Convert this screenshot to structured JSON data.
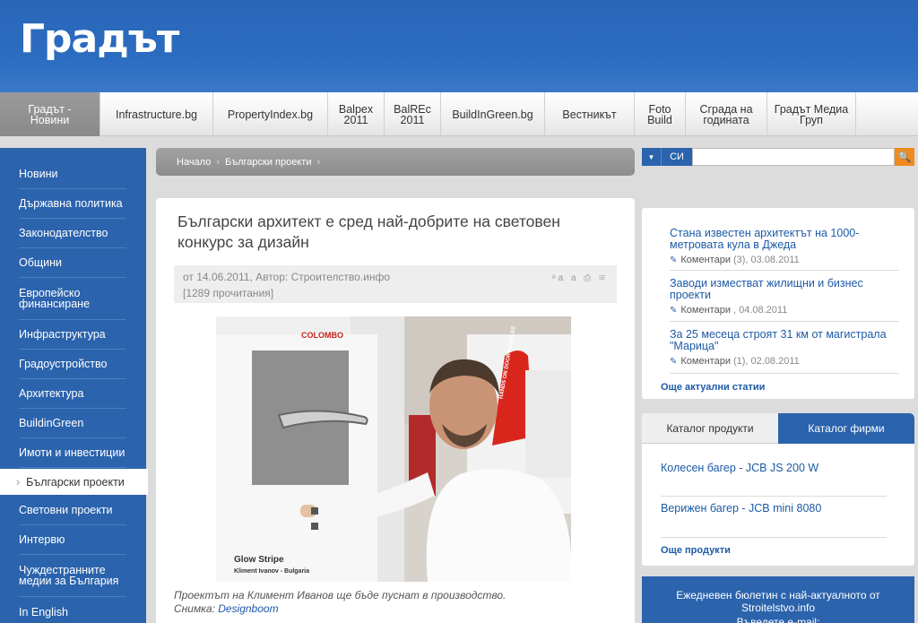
{
  "logo": "Градът",
  "topnav": [
    {
      "label": "Градът -\nНовини",
      "active": true
    },
    {
      "label": "Infrastructure.bg"
    },
    {
      "label": "PropertyIndex.bg"
    },
    {
      "label": "Balpex\n2011"
    },
    {
      "label": "BalREc\n2011"
    },
    {
      "label": "BuildInGreen.bg"
    },
    {
      "label": "Вестникът"
    },
    {
      "label": "Foto\nBuild"
    },
    {
      "label": "Сграда на\nгодината"
    },
    {
      "label": "Градът Медиа\nГруп"
    }
  ],
  "sidebar": [
    {
      "label": "Новини"
    },
    {
      "label": "Държавна политика"
    },
    {
      "label": "Законодателство"
    },
    {
      "label": "Общини"
    },
    {
      "label": "Европейско финансиране"
    },
    {
      "label": "Инфраструктура"
    },
    {
      "label": "Градоустройство"
    },
    {
      "label": "Архитектура"
    },
    {
      "label": "BuildinGreen"
    },
    {
      "label": "Имоти и инвестиции"
    },
    {
      "label": "Български проекти",
      "active": true
    },
    {
      "label": "Световни проекти"
    },
    {
      "label": "Интервю"
    },
    {
      "label": "Чуждестранните медии за България"
    },
    {
      "label": "In English"
    }
  ],
  "breadcrumb": {
    "home": "Начало",
    "current": "Български проекти",
    "sep": "›"
  },
  "article": {
    "title": "Български архитект е сред най-добрите на световен конкурс за дизайн",
    "meta_line1": "от 14.06.2011, Автор: Строителство.инфо",
    "meta_line2": "[1289 прочитания]",
    "tools": "ᵃa a ⎙ ✉",
    "photo_text": {
      "brand": "COLOMBO",
      "product": "Glow Stripe",
      "author": "Kliment Ivanov - Bulgaria",
      "sign": "HANDS ON DOOR HANDLES"
    },
    "caption": "Проектът на Климент Иванов ще бъде пуснат в производство.",
    "credit_label": "Снимка: ",
    "credit_link": "Designboom"
  },
  "search": {
    "dropdown": "▼",
    "lang": "СИ",
    "placeholder": "",
    "go": "🔍"
  },
  "news": {
    "items": [
      {
        "title": "Стана известен архитектът на 1000-метровата кула в Джеда",
        "comments_label": "Коментари",
        "meta": "(3), 03.08.2011"
      },
      {
        "title": "Заводи изместват жилищни и бизнес проекти",
        "comments_label": "Коментари",
        "meta": ", 04.08.2011"
      },
      {
        "title": "За 25 месеца строят 31 км от магистрала \"Марица\"",
        "comments_label": "Коментари",
        "meta": "(1), 02.08.2011"
      }
    ],
    "more": "Още актуални статии"
  },
  "catalog": {
    "tab_products": "Каталог продукти",
    "tab_companies": "Каталог фирми",
    "items": [
      "Колесен багер - JCB JS 200 W",
      "Верижен багер - JCB mini 8080"
    ],
    "more": "Още продукти"
  },
  "newsletter": {
    "line1": "Ежедневен бюлетин с най-актуалното от",
    "line2": "Stroitelstvo.info",
    "email_label": "Въведете e-mail:"
  }
}
